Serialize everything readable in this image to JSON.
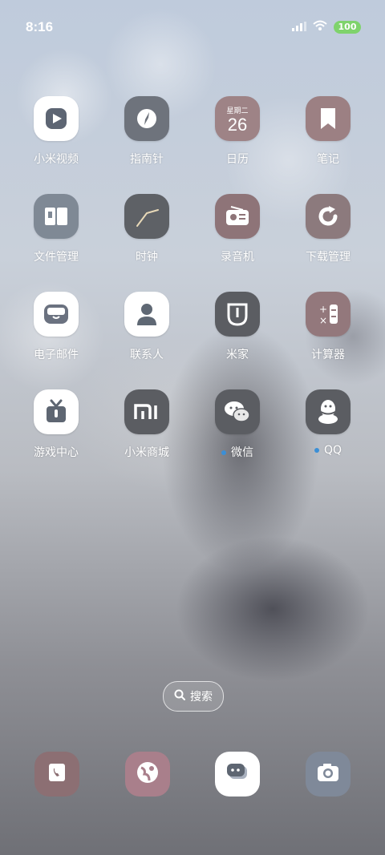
{
  "status_bar": {
    "time": "8:16",
    "battery": "100",
    "icons": [
      "signal-icon",
      "wifi-icon",
      "battery-icon"
    ]
  },
  "apps": [
    {
      "label": "小米视频",
      "icon": "video-play-icon",
      "bg": "#ffffff"
    },
    {
      "label": "指南针",
      "icon": "compass-icon",
      "bg": "#6e737c"
    },
    {
      "label": "日历",
      "icon": "calendar-icon",
      "bg": "#9e8386",
      "weekday": "星期二",
      "day": "26"
    },
    {
      "label": "笔记",
      "icon": "bookmark-icon",
      "bg": "#9c8083"
    },
    {
      "label": "文件管理",
      "icon": "folder-icon",
      "bg": "#7f8995"
    },
    {
      "label": "时钟",
      "icon": "clock-icon",
      "bg": "#5e6166"
    },
    {
      "label": "录音机",
      "icon": "radio-recorder-icon",
      "bg": "#8e7478"
    },
    {
      "label": "下载管理",
      "icon": "download-refresh-icon",
      "bg": "#8c7a7d"
    },
    {
      "label": "电子邮件",
      "icon": "mail-inbox-icon",
      "bg": "#ffffff"
    },
    {
      "label": "联系人",
      "icon": "person-icon",
      "bg": "#ffffff"
    },
    {
      "label": "米家",
      "icon": "mijia-icon",
      "bg": "#5b5d62"
    },
    {
      "label": "计算器",
      "icon": "calculator-icon",
      "bg": "#93787c"
    },
    {
      "label": "游戏中心",
      "icon": "gift-box-icon",
      "bg": "#ffffff"
    },
    {
      "label": "小米商城",
      "icon": "mi-logo-icon",
      "bg": "#5b5d62"
    },
    {
      "label": "微信",
      "icon": "wechat-icon",
      "bg": "#5b5d62",
      "dot": true
    },
    {
      "label": "QQ",
      "icon": "qq-penguin-icon",
      "bg": "#5b5d62",
      "dot": true
    }
  ],
  "search": {
    "label": "搜索"
  },
  "dock": [
    {
      "name": "phone",
      "icon": "phone-icon",
      "bg": "#8c6f73"
    },
    {
      "name": "browser",
      "icon": "browser-globe-icon",
      "bg": "#a97f8b"
    },
    {
      "name": "messages",
      "icon": "message-bubble-icon",
      "bg": "#ffffff"
    },
    {
      "name": "camera",
      "icon": "camera-icon",
      "bg": "#7f8999"
    }
  ]
}
